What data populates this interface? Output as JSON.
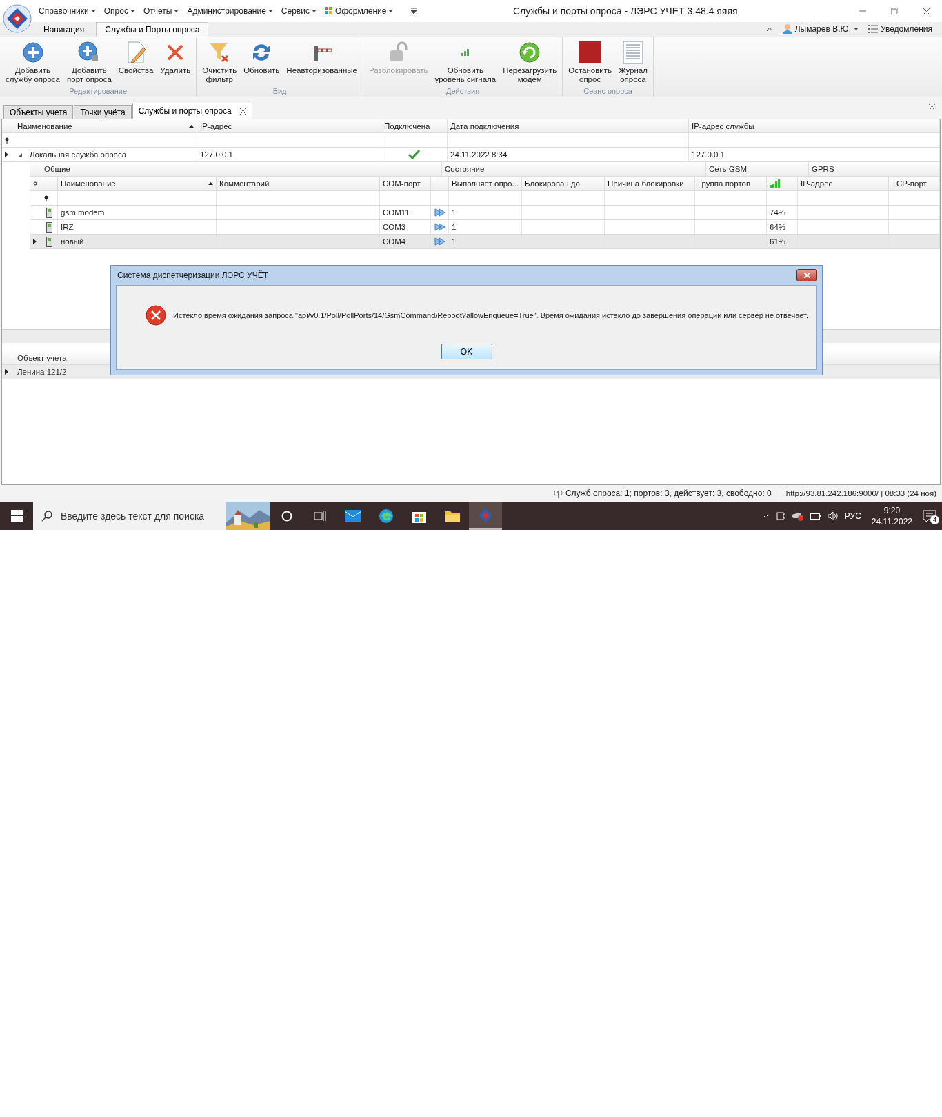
{
  "app": {
    "title": "Службы и порты опроса - ЛЭРС УЧЕТ 3.48.4 яяяя",
    "menu": [
      {
        "label": "Справочники",
        "kind": "plain"
      },
      {
        "label": "Опрос",
        "kind": "plain"
      },
      {
        "label": "Отчеты",
        "kind": "plain"
      },
      {
        "label": "Администрирование",
        "kind": "plain"
      },
      {
        "label": "Сервис",
        "kind": "plain"
      },
      {
        "label": "Оформление",
        "kind": "flag"
      }
    ],
    "ribbon_tabs": [
      {
        "label": "Навигация",
        "selected": false
      },
      {
        "label": "Службы и Порты опроса",
        "selected": true
      }
    ],
    "user": "Лымарев В.Ю.",
    "notifications": "Уведомления"
  },
  "ribbon_groups": [
    {
      "label": "Редактирование",
      "buttons": [
        {
          "label": "Добавить\nслужбу опроса",
          "kind": "add",
          "disabled": false
        },
        {
          "label": "Добавить\nпорт опроса",
          "kind": "add-port",
          "disabled": false
        },
        {
          "label": "Свойства",
          "kind": "edit",
          "disabled": false
        },
        {
          "label": "Удалить",
          "kind": "delete",
          "disabled": false
        }
      ]
    },
    {
      "label": "Вид",
      "buttons": [
        {
          "label": "Очистить\nфильтр",
          "kind": "filter",
          "disabled": false
        },
        {
          "label": "Обновить",
          "kind": "refresh",
          "disabled": false
        },
        {
          "label": "Неавторизованные",
          "kind": "barrier",
          "disabled": false
        }
      ]
    },
    {
      "label": "Действия",
      "buttons": [
        {
          "label": "Разблокировать",
          "kind": "lock",
          "disabled": true
        },
        {
          "label": "Обновить\nуровень сигнала",
          "kind": "signal",
          "disabled": false
        },
        {
          "label": "Перезагрузить\nмодем",
          "kind": "reload",
          "disabled": false
        }
      ]
    },
    {
      "label": "Сеанс опроса",
      "buttons": [
        {
          "label": "Остановить\nопрос",
          "kind": "stop",
          "disabled": false
        },
        {
          "label": "Журнал\nопроса",
          "kind": "journal",
          "disabled": false
        }
      ]
    }
  ],
  "doc_tabs": [
    {
      "label": "Объекты учета",
      "selected": false,
      "closable": false
    },
    {
      "label": "Точки учёта",
      "selected": false,
      "closable": false
    },
    {
      "label": "Службы и порты опроса",
      "selected": true,
      "closable": true
    }
  ],
  "services": {
    "columns": [
      "Наименование",
      "IP-адрес",
      "Подключена",
      "Дата подключения",
      "IP-адрес службы"
    ],
    "rows": [
      {
        "name": "Локальная служба опроса",
        "ip": "127.0.0.1",
        "connected": true,
        "date": "24.11.2022 8:34",
        "service_ip": "127.0.0.1",
        "focused": true,
        "expanded": true,
        "ports": {
          "bands": [
            "Общие",
            "Состояние",
            "Сеть GSM",
            "GPRS"
          ],
          "columns": [
            "Наименование",
            "Комментарий",
            "COM-порт",
            "Выполняет опро...",
            "Блокирован до",
            "Причина блокировки",
            "Группа портов",
            "IP-адрес",
            "TCP-порт"
          ],
          "rows": [
            {
              "name": "gsm modem",
              "com": "COM11",
              "runs": "1",
              "signal": "74%",
              "focused": false
            },
            {
              "name": "IRZ",
              "com": "COM3",
              "runs": "1",
              "signal": "64%",
              "focused": false
            },
            {
              "name": "новый",
              "com": "COM4",
              "runs": "1",
              "signal": "61%",
              "focused": true
            }
          ]
        }
      }
    ]
  },
  "objects": {
    "column": "Объект учета",
    "rows": [
      {
        "name": "Ленина 121/2",
        "focused": true
      }
    ]
  },
  "dialog": {
    "title": "Система диспетчеризации ЛЭРС УЧЁТ",
    "message": "Истекло время ожидания запроса \"api/v0.1/Poll/PollPorts/14/GsmCommand/Reboot?allowEnqueue=True\". Время ожидания истекло до завершения операции или сервер не отвечает.",
    "button": "OK"
  },
  "status_bar": {
    "summary": "Служб опроса: 1; портов: 3, действует: 3, свободно: 0",
    "server": "http://93.81.242.186:9000/ | 08:33 (24 ноя)"
  },
  "taskbar": {
    "search_placeholder": "Введите здесь текст для поиска",
    "language": "РУС",
    "time": "9:20",
    "date": "24.11.2022",
    "notification_count": "4"
  }
}
